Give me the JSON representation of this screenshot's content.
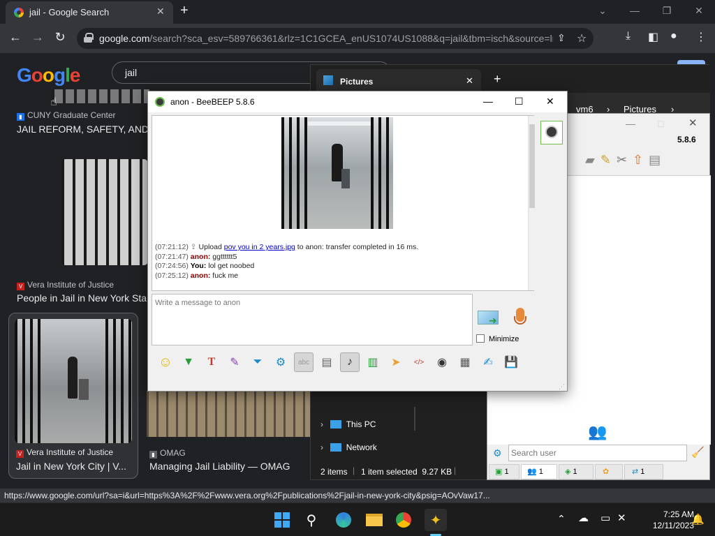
{
  "browser": {
    "tab_title": "jail - Google Search",
    "url_host": "google.com",
    "url_rest": "/search?sca_esv=589766361&rlz=1C1GCEA_enUS1074US1088&q=jail&tbm=isch&source=lnm...",
    "search_query": "jail",
    "logo": "Google"
  },
  "results": [
    {
      "source": "CUNY Graduate Center",
      "title": "JAIL REFORM, SAFETY, AND J"
    },
    {
      "source": "Vera Institute of Justice",
      "title": "People in Jail in New York Sta"
    },
    {
      "source": "Vera Institute of Justice",
      "title": "Jail in New York City | V..."
    },
    {
      "source": "OMAG",
      "title": "Managing Jail Liability — OMAG"
    }
  ],
  "explorer": {
    "tab_title": "Pictures",
    "crumbs": [
      "vm6",
      "Pictures"
    ],
    "tree": [
      "This PC",
      "Network"
    ],
    "status_items": "2 items",
    "status_selected": "1 item selected  9.27 KB"
  },
  "beebeep_main": {
    "version": "5.8.6",
    "search_placeholder": "Search user",
    "tabs": [
      "1",
      "1",
      "1",
      "1"
    ]
  },
  "chat": {
    "title": "anon - BeeBEEP 5.8.6",
    "messages": [
      {
        "time": "(07:21:12)",
        "pre": "Upload ",
        "link": "pov you in 2 years.jpg",
        "post": " to anon: transfer completed in 16 ms."
      },
      {
        "time": "(07:21:47)",
        "sender": "anon:",
        "text": " ggtttttt5"
      },
      {
        "time": "(07:24:56)",
        "sender": "You:",
        "text": " lol get noobed"
      },
      {
        "time": "(07:25:12)",
        "sender": "anon:",
        "text": " fuck me"
      }
    ],
    "compose_placeholder": "Write a message to anon",
    "minimize_label": "Minimize"
  },
  "status_url": "https://www.google.com/url?sa=i&url=https%3A%2F%2Fwww.vera.org%2Fpublications%2Fjail-in-new-york-city&psig=AOvVaw17...",
  "taskbar": {
    "time": "7:25 AM",
    "date": "12/11/2023"
  },
  "colors": {
    "chrome_bg": "#202124",
    "chrome_toolbar": "#35363a",
    "beebeep_green": "#6bbf4a",
    "anon_red": "#8b0000"
  }
}
